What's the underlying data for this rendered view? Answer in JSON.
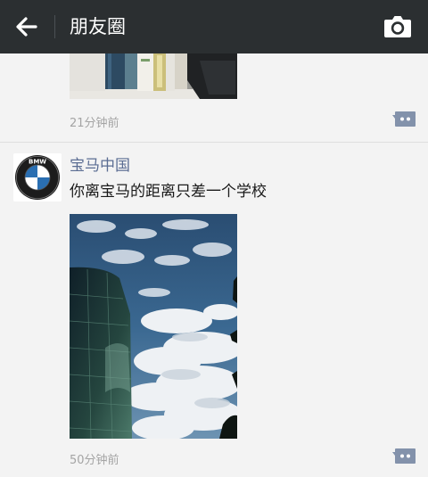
{
  "header": {
    "title": "朋友圈",
    "back_icon": "arrow-left-icon",
    "camera_icon": "camera-icon",
    "background": "#2b2f31"
  },
  "posts": [
    {
      "time": "21分钟前",
      "image": "books-on-shelf-photo",
      "comment_icon": "comment-bubble-icon"
    },
    {
      "author": "宝马中国",
      "avatar": "bmw-logo",
      "avatar_text": "BMW",
      "text": "你离宝马的距离只差一个学校",
      "image": "glass-building-and-cloudy-sky-photo",
      "time": "50分钟前",
      "comment_icon": "comment-bubble-icon"
    }
  ],
  "colors": {
    "author_name": "#5b6d93",
    "comment_button": "#8392ab",
    "timestamp": "#a4a4a4"
  }
}
